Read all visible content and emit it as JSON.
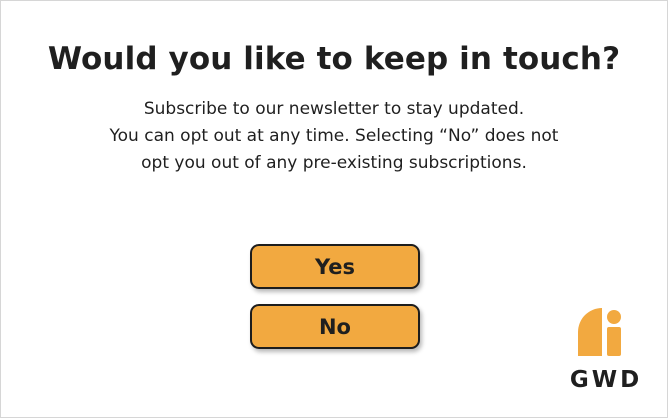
{
  "dialog": {
    "title": "Would you like to keep in touch?",
    "body_lines": [
      "Subscribe to our newsletter to stay updated.",
      "You can opt out at any time. Selecting “No” does not",
      "opt you out of any pre-existing subscriptions."
    ],
    "yes_label": "Yes",
    "no_label": "No"
  },
  "logo": {
    "text": "GWD",
    "icon": "gwd-logo-icon"
  },
  "colors": {
    "button_fill": "#f2a940",
    "logo_orange": "#f2a940",
    "text": "#1f1f1f"
  }
}
